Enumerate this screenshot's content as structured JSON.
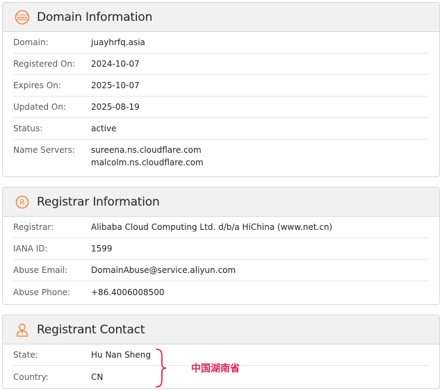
{
  "domain_info": {
    "title": "Domain Information",
    "icon": "www-globe-icon",
    "rows": [
      {
        "label": "Domain:",
        "value": "juayhrfq.asia"
      },
      {
        "label": "Registered On:",
        "value": "2024-10-07"
      },
      {
        "label": "Expires On:",
        "value": "2025-10-07"
      },
      {
        "label": "Updated On:",
        "value": "2025-08-19"
      },
      {
        "label": "Status:",
        "value": "active"
      }
    ],
    "name_servers": {
      "label": "Name Servers:",
      "values": [
        "sureena.ns.cloudflare.com",
        "malcolm.ns.cloudflare.com"
      ]
    }
  },
  "registrar_info": {
    "title": "Registrar Information",
    "icon": "registered-trademark-icon",
    "rows": [
      {
        "label": "Registrar:",
        "value": "Alibaba Cloud Computing Ltd. d/b/a HiChina (www.net.cn)"
      },
      {
        "label": "IANA ID:",
        "value": "1599"
      },
      {
        "label": "Abuse Email:",
        "value": "DomainAbuse@service.aliyun.com"
      },
      {
        "label": "Abuse Phone:",
        "value": "+86.4006008500"
      }
    ]
  },
  "registrant_contact": {
    "title": "Registrant Contact",
    "icon": "person-icon",
    "rows": [
      {
        "label": "State:",
        "value": "Hu Nan Sheng"
      },
      {
        "label": "Country:",
        "value": "CN"
      }
    ]
  },
  "annotation": {
    "text": "中国湖南省",
    "color": "#e0245e"
  },
  "colors": {
    "accent_icon": "#f0883e",
    "header_bg": "#f1f1f1",
    "border": "#d6d6d6"
  }
}
